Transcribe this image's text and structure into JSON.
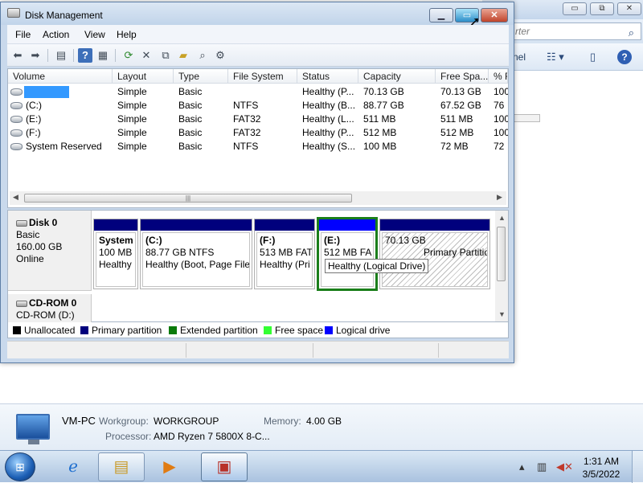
{
  "background_window": {
    "search_placeholder": "rter",
    "toolbar_partial_label": "nel",
    "caption_buttons": [
      "▭",
      "⧉",
      "✕"
    ]
  },
  "window": {
    "title": "Disk Management",
    "menu": [
      "File",
      "Action",
      "View",
      "Help"
    ]
  },
  "toolbar": {
    "icons": [
      "back-icon",
      "forward-icon",
      "console-tree-icon",
      "help-icon",
      "show-hide-icon",
      "refresh-icon",
      "delete-icon",
      "properties-icon",
      "open-icon",
      "search-icon",
      "settings-icon"
    ]
  },
  "volume_list": {
    "columns": [
      "Volume",
      "Layout",
      "Type",
      "File System",
      "Status",
      "Capacity",
      "Free Spa...",
      "% F"
    ],
    "rows": [
      {
        "volume": "",
        "layout": "Simple",
        "type": "Basic",
        "fs": "",
        "status": "Healthy (P...",
        "capacity": "70.13 GB",
        "free": "70.13 GB",
        "pct": "100",
        "selected": true
      },
      {
        "volume": "(C:)",
        "layout": "Simple",
        "type": "Basic",
        "fs": "NTFS",
        "status": "Healthy (B...",
        "capacity": "88.77 GB",
        "free": "67.52 GB",
        "pct": "76"
      },
      {
        "volume": "(E:)",
        "layout": "Simple",
        "type": "Basic",
        "fs": "FAT32",
        "status": "Healthy (L...",
        "capacity": "511 MB",
        "free": "511 MB",
        "pct": "100"
      },
      {
        "volume": "(F:)",
        "layout": "Simple",
        "type": "Basic",
        "fs": "FAT32",
        "status": "Healthy (P...",
        "capacity": "512 MB",
        "free": "512 MB",
        "pct": "100"
      },
      {
        "volume": "System Reserved",
        "layout": "Simple",
        "type": "Basic",
        "fs": "NTFS",
        "status": "Healthy (S...",
        "capacity": "100 MB",
        "free": "72 MB",
        "pct": "72"
      }
    ]
  },
  "disk0": {
    "name": "Disk 0",
    "type": "Basic",
    "size": "160.00 GB",
    "state": "Online",
    "partitions": [
      {
        "name": "System",
        "line2": "100 MB",
        "line3": "Healthy"
      },
      {
        "name": "(C:)",
        "line2": "88.77 GB NTFS",
        "line3": "Healthy (Boot, Page File"
      },
      {
        "name": "(F:)",
        "line2": "513 MB FAT",
        "line3": "Healthy (Pri"
      },
      {
        "name": "(E:)",
        "line2": "512 MB FA",
        "line3": ""
      },
      {
        "name": "",
        "line2": "70.13 GB",
        "line3": "Primary Partitio"
      }
    ],
    "tooltip": "Healthy (Logical Drive)"
  },
  "cdrom": {
    "name": "CD-ROM 0",
    "drive": "CD-ROM (D:)"
  },
  "legend": [
    {
      "label": "Unallocated",
      "color": "#000000"
    },
    {
      "label": "Primary partition",
      "color": "#00007d"
    },
    {
      "label": "Extended partition",
      "color": "#0a7a0a"
    },
    {
      "label": "Free space",
      "color": "#33ff33"
    },
    {
      "label": "Logical drive",
      "color": "#0000ff"
    }
  ],
  "details": {
    "computer_name": "VM-PC",
    "workgroup_label": "Workgroup:",
    "workgroup_value": "WORKGROUP",
    "memory_label": "Memory:",
    "memory_value": "4.00 GB",
    "processor_label": "Processor:",
    "processor_value": "AMD Ryzen 7 5800X 8-C..."
  },
  "taskbar": {
    "time": "1:31 AM",
    "date": "3/5/2022"
  }
}
